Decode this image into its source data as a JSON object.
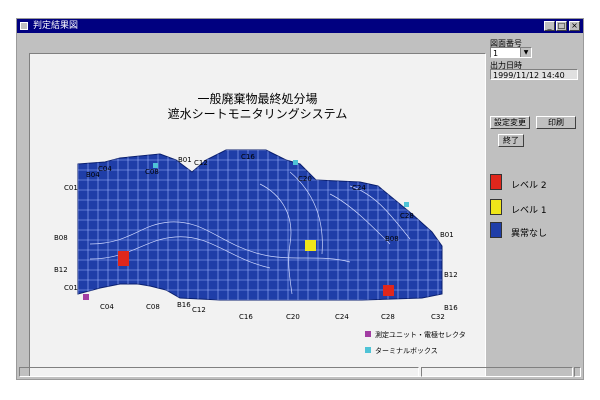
{
  "window": {
    "title": "判定結果図"
  },
  "map": {
    "title_line1": "一般廃棄物最終処分場",
    "title_line2": "遮水シートモニタリングシステム",
    "labels": {
      "top_c01": "C01",
      "top_b04": "B04",
      "top_c04": "C04",
      "top_c08": "C08",
      "top_b01": "B01",
      "top_c12": "C12",
      "top_c16": "C16",
      "top_c20": "C20",
      "top_c24": "C24",
      "top_c28": "C28",
      "right_b01": "B01",
      "inner_b08": "B08",
      "right_b12": "B12",
      "right_b16": "B16",
      "left_b08": "B08",
      "left_b12": "B12",
      "left_c01": "C01",
      "bottom_c04": "C04",
      "bottom_c08": "C08",
      "bottom_b16": "B16",
      "bottom_c12": "C12",
      "bottom_c16": "C16",
      "bottom_c20": "C20",
      "bottom_c24": "C24",
      "bottom_c28": "C28",
      "bottom_c32": "C32"
    },
    "point_legend": {
      "unit": "測定ユニット・電極セレクタ",
      "terminal": "ターミナルボックス"
    },
    "colors": {
      "sheet": "#1f3ea8",
      "grid": "#9fb4ff",
      "level2": "#e0271c",
      "level1": "#f0e61a",
      "unit": "#a23da3",
      "terminal": "#4fc3d6"
    }
  },
  "sidebar": {
    "drawing_no_label": "図面番号",
    "drawing_no_value": "1",
    "output_time_label": "出力日時",
    "output_time_value": "1999/11/12 14:40",
    "settings_button": "設定変更",
    "print_button": "印刷",
    "exit_button": "終了",
    "legend": [
      {
        "label": "レベル 2",
        "color": "#e0271c"
      },
      {
        "label": "レベル 1",
        "color": "#f0e61a"
      },
      {
        "label": "異常なし",
        "color": "#1f3ea8"
      }
    ]
  }
}
